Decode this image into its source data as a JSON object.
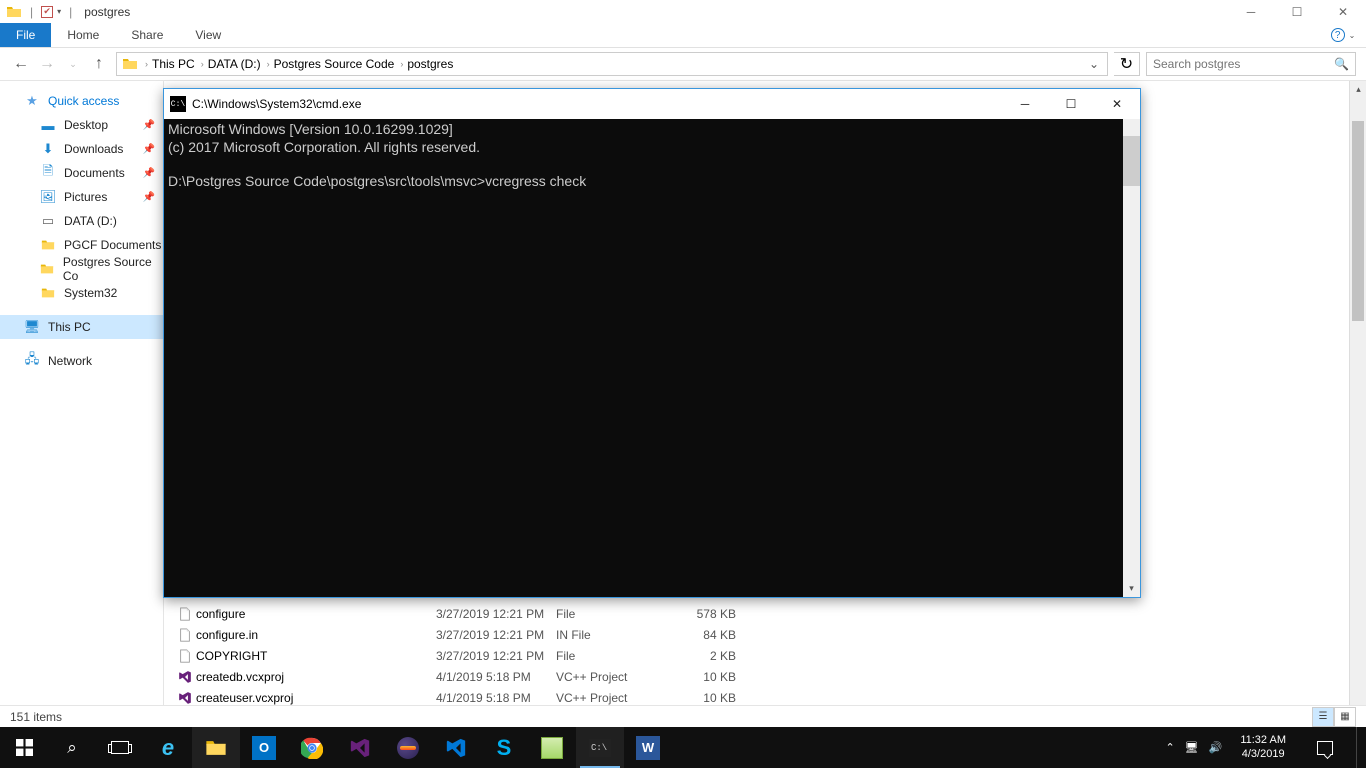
{
  "titlebar": {
    "title": "postgres"
  },
  "ribbon": {
    "file": "File",
    "home": "Home",
    "share": "Share",
    "view": "View"
  },
  "breadcrumb": [
    "This PC",
    "DATA (D:)",
    "Postgres Source Code",
    "postgres"
  ],
  "search": {
    "placeholder": "Search postgres"
  },
  "sidebar": {
    "quickaccess": "Quick access",
    "items": [
      {
        "label": "Desktop",
        "pin": true
      },
      {
        "label": "Downloads",
        "pin": true
      },
      {
        "label": "Documents",
        "pin": true
      },
      {
        "label": "Pictures",
        "pin": true
      },
      {
        "label": "DATA (D:)"
      },
      {
        "label": "PGCF Documents"
      },
      {
        "label": "Postgres Source Co"
      },
      {
        "label": "System32"
      }
    ],
    "thispc": "This PC",
    "network": "Network"
  },
  "files": [
    {
      "name": "configure",
      "date": "3/27/2019 12:21 PM",
      "type": "File",
      "size": "578 KB",
      "icon": "file"
    },
    {
      "name": "configure.in",
      "date": "3/27/2019 12:21 PM",
      "type": "IN File",
      "size": "84 KB",
      "icon": "file"
    },
    {
      "name": "COPYRIGHT",
      "date": "3/27/2019 12:21 PM",
      "type": "File",
      "size": "2 KB",
      "icon": "file"
    },
    {
      "name": "createdb.vcxproj",
      "date": "4/1/2019 5:18 PM",
      "type": "VC++ Project",
      "size": "10 KB",
      "icon": "vs"
    },
    {
      "name": "createuser.vcxproj",
      "date": "4/1/2019 5:18 PM",
      "type": "VC++ Project",
      "size": "10 KB",
      "icon": "vs"
    }
  ],
  "status": {
    "count": "151 items"
  },
  "cmd": {
    "title": "C:\\Windows\\System32\\cmd.exe",
    "line1": "Microsoft Windows [Version 10.0.16299.1029]",
    "line2": "(c) 2017 Microsoft Corporation. All rights reserved.",
    "prompt": "D:\\Postgres Source Code\\postgres\\src\\tools\\msvc>vcregress check"
  },
  "tray": {
    "time": "11:32 AM",
    "date": "4/3/2019"
  }
}
